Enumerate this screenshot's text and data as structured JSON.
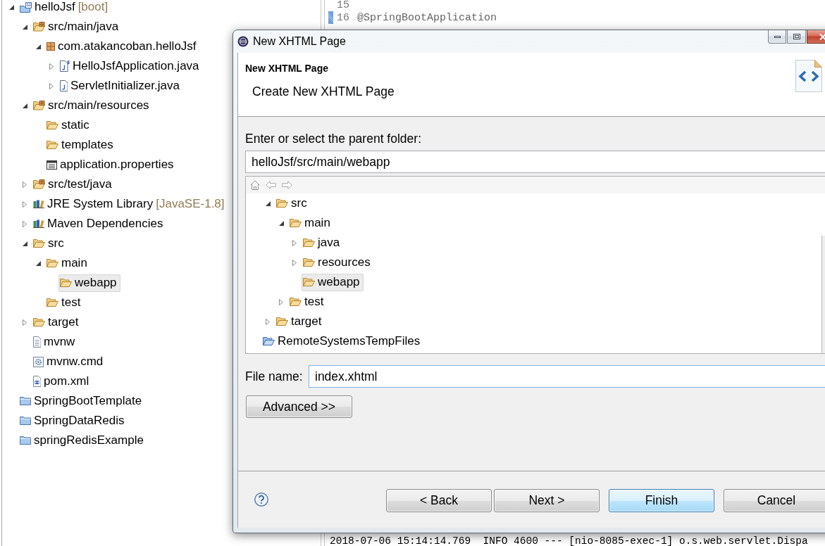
{
  "project_explorer": {
    "items": [
      {
        "label": "helloJsf",
        "decoration": "[boot]",
        "kind": "spring-project",
        "expanded": true,
        "selected": false,
        "children": [
          {
            "label": "src/main/java",
            "kind": "source-folder",
            "expanded": true,
            "selected": false,
            "children": [
              {
                "label": "com.atakancoban.helloJsf",
                "kind": "package",
                "expanded": true,
                "selected": false,
                "children": [
                  {
                    "label": "HelloJsfApplication.java",
                    "kind": "spring-java",
                    "expanded": false,
                    "selected": false
                  },
                  {
                    "label": "ServletInitializer.java",
                    "kind": "java",
                    "expanded": false,
                    "selected": false
                  }
                ]
              }
            ]
          },
          {
            "label": "src/main/resources",
            "kind": "source-folder",
            "expanded": true,
            "selected": false,
            "children": [
              {
                "label": "static",
                "kind": "folder",
                "selected": false
              },
              {
                "label": "templates",
                "kind": "folder",
                "selected": false
              },
              {
                "label": "application.properties",
                "kind": "properties",
                "selected": false
              }
            ]
          },
          {
            "label": "src/test/java",
            "kind": "source-folder",
            "expanded": false,
            "selected": false
          },
          {
            "label": "JRE System Library",
            "decoration": "[JavaSE-1.8]",
            "kind": "library",
            "expanded": false,
            "selected": false
          },
          {
            "label": "Maven Dependencies",
            "kind": "library",
            "expanded": false,
            "selected": false
          },
          {
            "label": "src",
            "kind": "folder",
            "expanded": true,
            "selected": false,
            "children": [
              {
                "label": "main",
                "kind": "folder",
                "expanded": true,
                "selected": false,
                "children": [
                  {
                    "label": "webapp",
                    "kind": "folder",
                    "selected": true
                  }
                ]
              },
              {
                "label": "test",
                "kind": "folder",
                "selected": false
              }
            ]
          },
          {
            "label": "target",
            "kind": "folder",
            "expanded": false,
            "selected": false
          },
          {
            "label": "mvnw",
            "kind": "file",
            "selected": false
          },
          {
            "label": "mvnw.cmd",
            "kind": "script",
            "selected": false
          },
          {
            "label": "pom.xml",
            "kind": "pom",
            "selected": false
          }
        ]
      },
      {
        "label": "SpringBootTemplate",
        "kind": "closed-project",
        "selected": false
      },
      {
        "label": "SpringDataRedis",
        "kind": "closed-project",
        "selected": false
      },
      {
        "label": "springRedisExample",
        "kind": "closed-project",
        "selected": false
      }
    ]
  },
  "editor": {
    "lines": [
      {
        "number": "15",
        "marked": false
      },
      {
        "number": "16",
        "code": "@SpringBootApplication",
        "marked": true
      }
    ]
  },
  "console": {
    "lines": [
      "2018-07-06 15:14:14.769  INFO 4600 --- [nio-8085-exec-1] o.s.web.servlet.Dispa"
    ]
  },
  "dialog": {
    "title": "New XHTML Page",
    "heading": "New XHTML Page",
    "description": "Create New XHTML Page",
    "folder_label": "Enter or select the parent folder:",
    "folder_field": {
      "value": "helloJsf/src/main/webapp",
      "focused": false
    },
    "folder_tree": {
      "items": [
        {
          "children": [
            {
              "label": "src",
              "kind": "folder",
              "expanded": true,
              "selected": false,
              "children": [
                {
                  "label": "main",
                  "kind": "folder",
                  "expanded": true,
                  "selected": false,
                  "children": [
                    {
                      "label": "java",
                      "kind": "folder",
                      "expanded": false,
                      "selected": false
                    },
                    {
                      "label": "resources",
                      "kind": "folder",
                      "expanded": false,
                      "selected": false
                    },
                    {
                      "label": "webapp",
                      "kind": "folder",
                      "selected": true
                    }
                  ]
                },
                {
                  "label": "test",
                  "kind": "folder",
                  "expanded": false,
                  "selected": false
                }
              ]
            },
            {
              "label": "target",
              "kind": "folder",
              "expanded": false,
              "selected": false
            }
          ]
        },
        {
          "label": "RemoteSystemsTempFiles",
          "kind": "open-project",
          "selected": false
        }
      ]
    },
    "file_name": {
      "label": "File name:",
      "value": "index.xhtml",
      "focused": true
    },
    "advanced_button": "Advanced >>",
    "buttons": [
      {
        "label": "< Back",
        "default": false
      },
      {
        "label": "Next >",
        "default": false
      },
      {
        "label": "Finish",
        "default": true
      },
      {
        "label": "Cancel",
        "default": false
      }
    ]
  }
}
